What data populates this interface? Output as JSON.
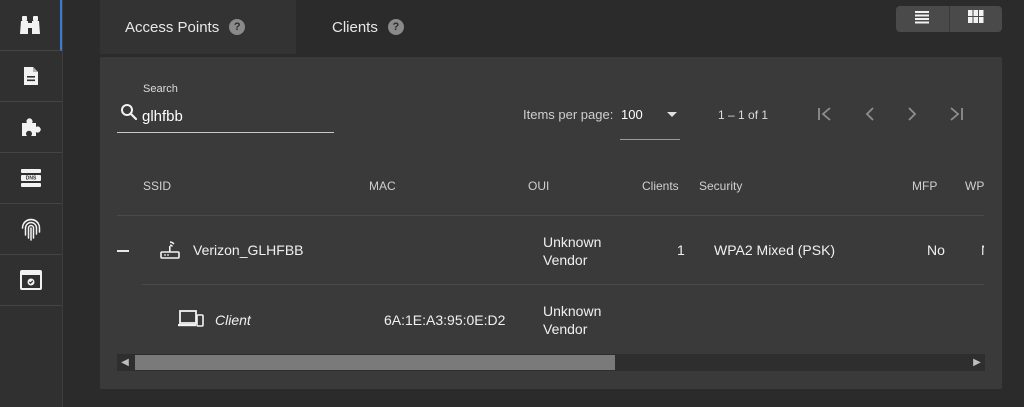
{
  "sidebar": {
    "items": [
      {
        "icon": "binoculars-icon",
        "active": true
      },
      {
        "icon": "document-icon"
      },
      {
        "icon": "puzzle-icon"
      },
      {
        "icon": "dns-server-icon"
      },
      {
        "icon": "fingerprint-icon"
      },
      {
        "icon": "browser-check-icon"
      }
    ],
    "dns_text": "DNS"
  },
  "tabs": [
    {
      "label": "Access Points",
      "help": "?"
    },
    {
      "label": "Clients",
      "help": "?"
    }
  ],
  "search": {
    "label": "Search",
    "value": "glhfbb"
  },
  "pagination": {
    "items_per_page_label": "Items per page:",
    "items_per_page": "100",
    "range": "1 – 1 of 1"
  },
  "table": {
    "headers": {
      "ssid": "SSID",
      "mac": "MAC",
      "oui": "OUI",
      "clients": "Clients",
      "security": "Security",
      "mfp": "MFP",
      "wps": "WPS"
    },
    "rows": [
      {
        "ssid": "Verizon_GLHFBB",
        "mac": "",
        "oui": "Unknown Vendor",
        "clients": "1",
        "security": "WPA2 Mixed (PSK)",
        "mfp": "No",
        "wps": "No"
      }
    ],
    "client_row": {
      "name": "Client",
      "mac": "6A:1E:A3:95:0E:D2",
      "oui": "Unknown Vendor"
    }
  },
  "colors": {
    "background": "#2b2b2b",
    "panel": "#3a3a3a",
    "sidebar": "#303030",
    "accent": "#3a7bd5"
  }
}
